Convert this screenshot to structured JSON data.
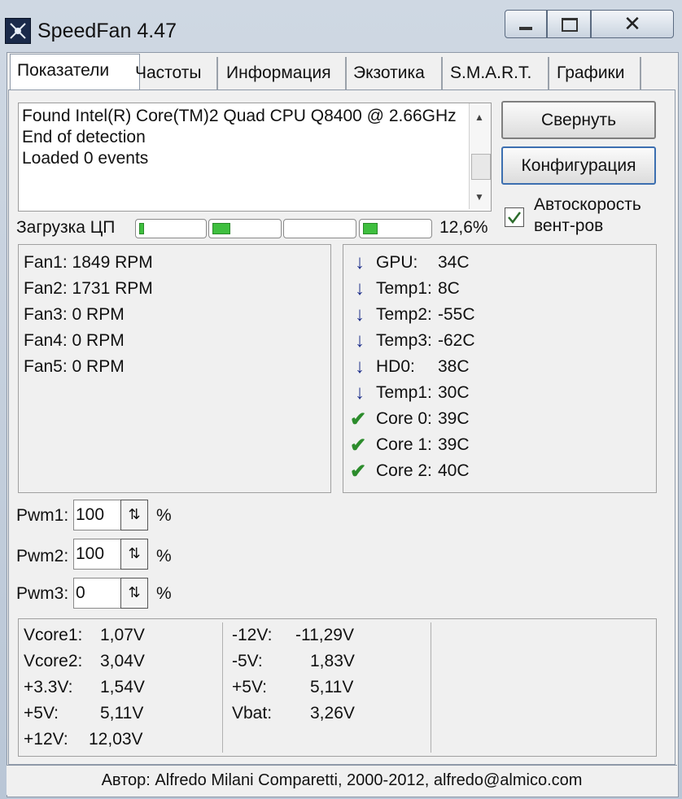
{
  "window": {
    "title": "SpeedFan 4.47",
    "close_glyph": "✕"
  },
  "tabs": [
    {
      "label": "Показатели"
    },
    {
      "label": "Частоты"
    },
    {
      "label": "Информация"
    },
    {
      "label": "Экзотика"
    },
    {
      "label": "S.M.A.R.T."
    },
    {
      "label": "Графики"
    }
  ],
  "log": {
    "lines": [
      "Found Intel(R) Core(TM)2 Quad CPU Q8400 @ 2.66GHz",
      "End of detection",
      "Loaded 0 events"
    ]
  },
  "buttons": {
    "minimize_label": "Свернуть",
    "config_label": "Конфигурация"
  },
  "auto_fan": {
    "label_line1": "Автоскорость",
    "label_line2": "вент-ров",
    "checked": true
  },
  "cpu": {
    "label": "Загрузка ЦП",
    "value": "12,6%",
    "core_levels": [
      0.05,
      0.25,
      0.0,
      0.2
    ],
    "bar_color": "#3fbf3f"
  },
  "fans": [
    "Fan1: 1849 RPM",
    "Fan2: 1731 RPM",
    "Fan3: 0 RPM",
    "Fan4: 0 RPM",
    "Fan5: 0 RPM"
  ],
  "temps": [
    {
      "status": "down-arrow-icon",
      "name": "GPU:",
      "value": "34C"
    },
    {
      "status": "down-arrow-icon",
      "name": "Temp1:",
      "value": "8C"
    },
    {
      "status": "down-arrow-icon",
      "name": "Temp2:",
      "value": "-55C"
    },
    {
      "status": "down-arrow-icon",
      "name": "Temp3:",
      "value": "-62C"
    },
    {
      "status": "down-arrow-icon",
      "name": "HD0:",
      "value": "38C"
    },
    {
      "status": "down-arrow-icon",
      "name": "Temp1:",
      "value": "30C"
    },
    {
      "status": "checkmark-icon",
      "name": "Core 0:",
      "value": "39C"
    },
    {
      "status": "checkmark-icon",
      "name": "Core 1:",
      "value": "39C"
    },
    {
      "status": "checkmark-icon",
      "name": "Core 2:",
      "value": "40C"
    }
  ],
  "pwm": [
    {
      "label": "Pwm1:",
      "value": "100",
      "unit": "%"
    },
    {
      "label": "Pwm2:",
      "value": "100",
      "unit": "%"
    },
    {
      "label": "Pwm3:",
      "value": "0",
      "unit": "%"
    }
  ],
  "voltages_left": [
    {
      "name": "Vcore1:",
      "value": "1,07V"
    },
    {
      "name": "Vcore2:",
      "value": "3,04V"
    },
    {
      "name": "+3.3V:",
      "value": "1,54V"
    },
    {
      "name": "+5V:",
      "value": "5,11V"
    },
    {
      "name": "+12V:",
      "value": "12,03V"
    }
  ],
  "voltages_right": [
    {
      "name": "-12V:",
      "value": "-11,29V"
    },
    {
      "name": "-5V:",
      "value": "1,83V"
    },
    {
      "name": "+5V:",
      "value": "5,11V"
    },
    {
      "name": "Vbat:",
      "value": "3,26V"
    }
  ],
  "status_bar": {
    "text": "Автор: Alfredo Milani Comparetti, 2000-2012, alfredo@almico.com"
  },
  "colors": {
    "arrow": "#1e2f8a",
    "check": "#2c8c2c"
  }
}
